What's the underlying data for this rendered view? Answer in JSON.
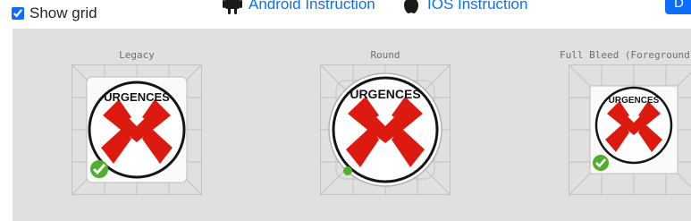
{
  "toolbar": {
    "show_grid_label": "Show grid",
    "show_grid_checked": true,
    "android_link": "Android Instruction",
    "ios_link": "IOS Instruction",
    "download_button": "D"
  },
  "previews": [
    {
      "label": "Legacy",
      "shape": "rounded-square"
    },
    {
      "label": "Round",
      "shape": "circle"
    },
    {
      "label": "Full Bleed (Foreground)",
      "shape": "full-bleed"
    }
  ],
  "icon": {
    "text": "URGENCES",
    "phone_color": "#dd1a10",
    "badge_color": "#4fae2e"
  }
}
